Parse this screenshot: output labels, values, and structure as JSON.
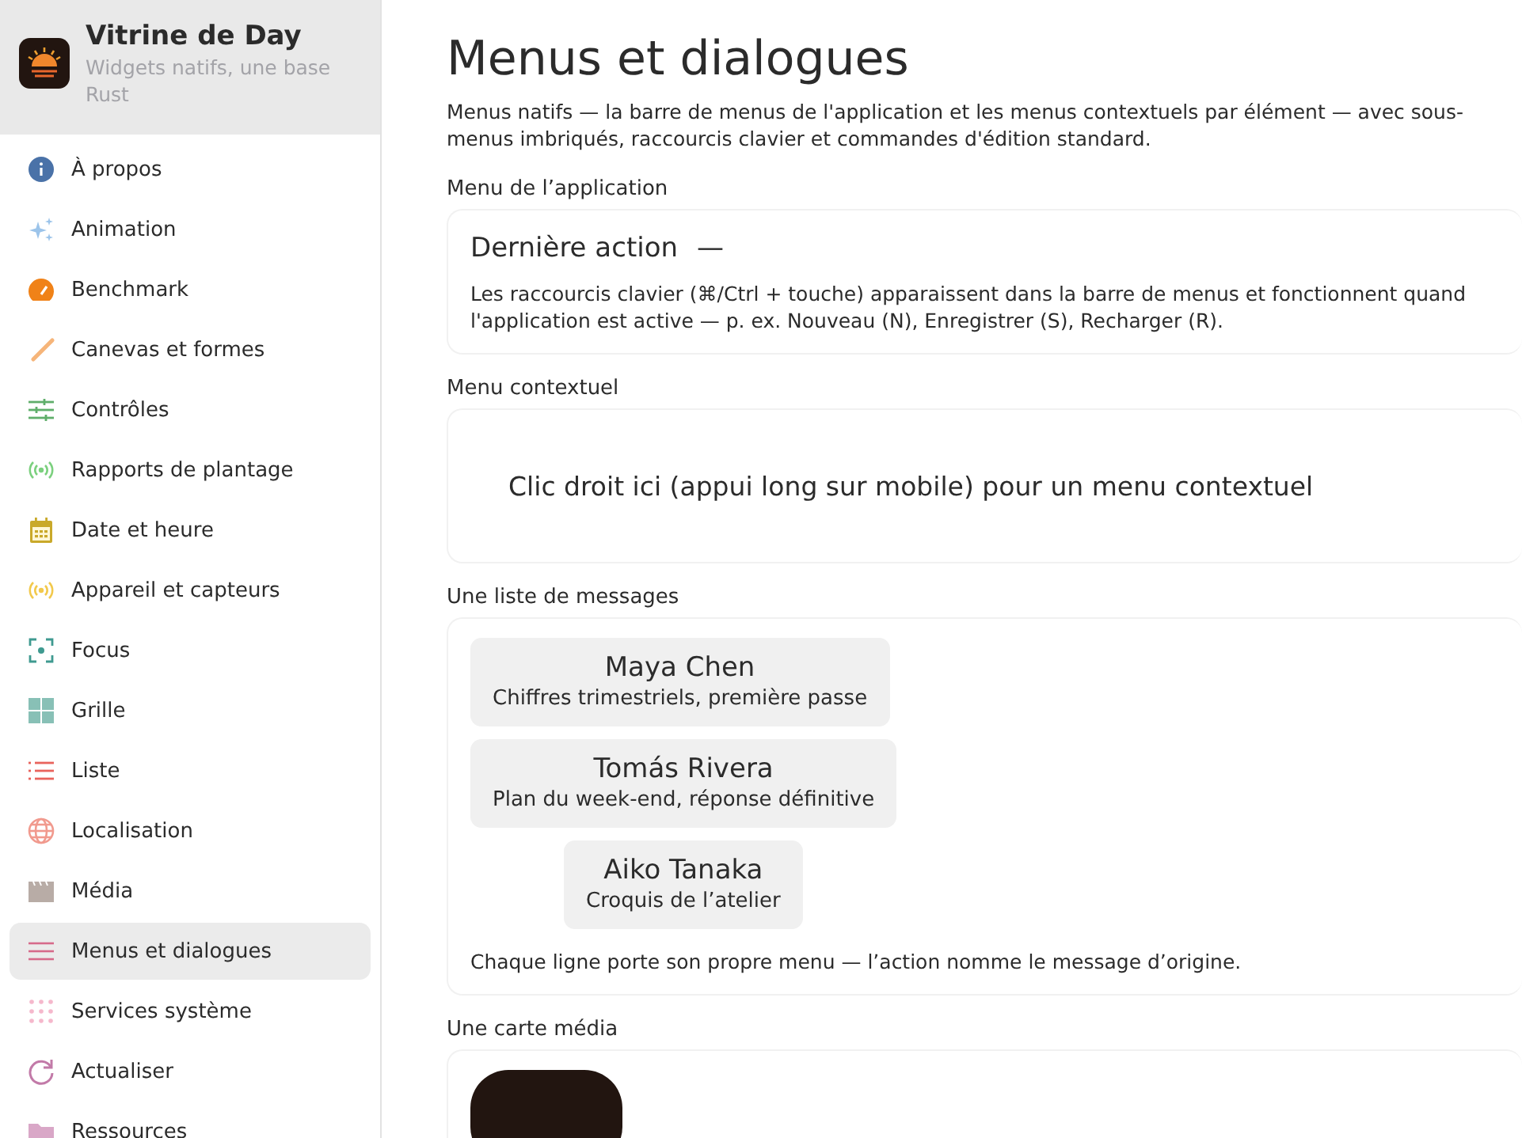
{
  "sidebar": {
    "app_title": "Vitrine de Day",
    "app_subtitle": "Widgets natifs, une base Rust",
    "items": [
      {
        "label": "À propos",
        "selected": false
      },
      {
        "label": "Animation",
        "selected": false
      },
      {
        "label": "Benchmark",
        "selected": false
      },
      {
        "label": "Canevas et formes",
        "selected": false
      },
      {
        "label": "Contrôles",
        "selected": false
      },
      {
        "label": "Rapports de plantage",
        "selected": false
      },
      {
        "label": "Date et heure",
        "selected": false
      },
      {
        "label": "Appareil et capteurs",
        "selected": false
      },
      {
        "label": "Focus",
        "selected": false
      },
      {
        "label": "Grille",
        "selected": false
      },
      {
        "label": "Liste",
        "selected": false
      },
      {
        "label": "Localisation",
        "selected": false
      },
      {
        "label": "Média",
        "selected": false
      },
      {
        "label": "Menus et dialogues",
        "selected": true
      },
      {
        "label": "Services système",
        "selected": false
      },
      {
        "label": "Actualiser",
        "selected": false
      },
      {
        "label": "Ressources",
        "selected": false
      }
    ]
  },
  "page": {
    "title": "Menus et dialogues",
    "description": "Menus natifs — la barre de menus de l'application et les menus contextuels par élément — avec sous-menus imbriqués, raccourcis clavier et commandes d'édition standard."
  },
  "sections": [
    {
      "kind": "app_menu",
      "label": "Menu de l’application",
      "last_action_label": "Dernière action",
      "last_action_value": "—",
      "note": "Les raccourcis clavier (⌘/Ctrl + touche) apparaissent dans la barre de menus et fonctionnent quand l'application est active — p. ex. Nouveau (N), Enregistrer (S), Recharger (R)."
    },
    {
      "kind": "context",
      "label": "Menu contextuel",
      "hint": "Clic droit ici (appui long sur mobile) pour un menu contextuel"
    },
    {
      "kind": "messages",
      "label": "Une liste de messages",
      "messages": [
        {
          "sender": "Maya Chen",
          "subject": "Chiffres trimestriels, première passe"
        },
        {
          "sender": "Tomás Rivera",
          "subject": "Plan du week-end, réponse définitive"
        },
        {
          "sender": "Aiko Tanaka",
          "subject": "Croquis de l’atelier"
        }
      ],
      "note": "Chaque ligne porte son propre menu — l’action nomme le message d’origine."
    },
    {
      "kind": "media",
      "label": "Une carte média"
    }
  ]
}
